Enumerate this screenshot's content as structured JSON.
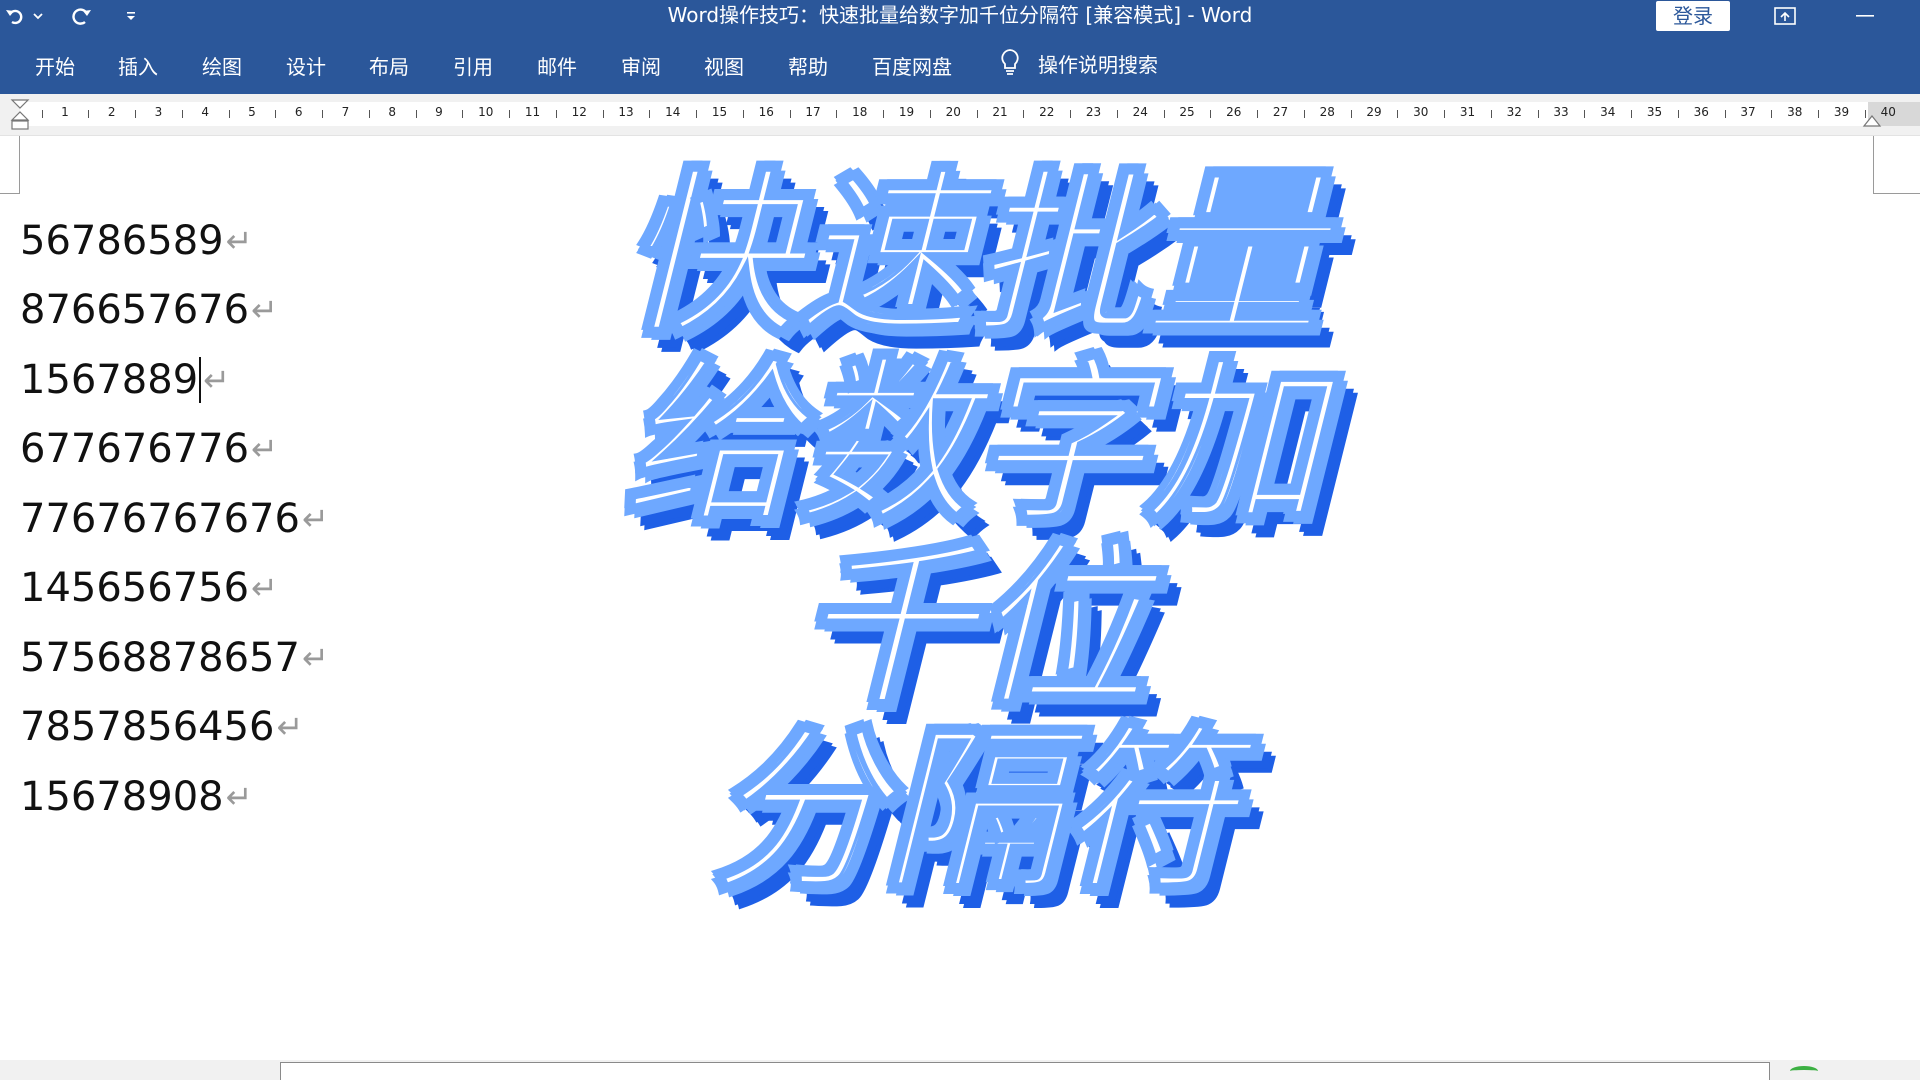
{
  "titlebar": {
    "title": "Word操作技巧：快速批量给数字加千位分隔符 [兼容模式]  -  Word",
    "login_label": "登录",
    "qat_icons": [
      "undo-icon",
      "chevron-down-icon",
      "redo-icon",
      "customize-qat-icon"
    ]
  },
  "ribbon": {
    "tabs": [
      "开始",
      "插入",
      "绘图",
      "设计",
      "布局",
      "引用",
      "邮件",
      "审阅",
      "视图",
      "帮助",
      "百度网盘"
    ],
    "tell_me": "操作说明搜索"
  },
  "ruler": {
    "numbers": [
      "1",
      "2",
      "3",
      "4",
      "5",
      "6",
      "7",
      "8",
      "9",
      "10",
      "11",
      "12",
      "13",
      "14",
      "15",
      "16",
      "17",
      "18",
      "19",
      "20",
      "21",
      "22",
      "23",
      "24",
      "25",
      "26",
      "27",
      "28",
      "29",
      "30",
      "31",
      "32",
      "33",
      "34",
      "35",
      "36",
      "37",
      "38",
      "39",
      "40"
    ]
  },
  "document": {
    "numbers": [
      "56786589",
      "876657676",
      "1567889",
      "677676776",
      "77676767676",
      "145656756",
      "57568878657",
      "7857856456",
      "15678908"
    ],
    "paragraph_mark": "↵",
    "caret_line": 2
  },
  "overlay": {
    "lines": [
      "快速批量",
      "给数字加",
      "千位",
      "分隔符"
    ]
  },
  "colors": {
    "ribbon": "#2b579a",
    "overlay_outline": "#6ea8ff",
    "overlay_shadow": "#1e5fe6"
  }
}
